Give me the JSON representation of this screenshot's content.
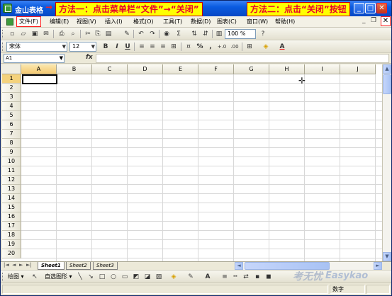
{
  "window": {
    "title": "金山表格",
    "title_arrow": "→",
    "controls": {
      "minimize": "_",
      "maximize": "□",
      "close": "✕"
    }
  },
  "annotations": {
    "method_one": "方法一：点击菜单栏“文件”→“关闭”",
    "method_two": "方法二：点击“关闭”按钮"
  },
  "menubar": {
    "items": [
      "文件(F)",
      "编辑(E)",
      "视图(V)",
      "插入(I)",
      "格式(O)",
      "工具(T)",
      "数据(D)",
      "图表(C)",
      "窗口(W)",
      "帮助(H)"
    ],
    "doc_controls": {
      "minimize": "_",
      "restore": "❐",
      "close": "✕"
    }
  },
  "toolbar": {
    "font_name": "宋体",
    "font_size": "12",
    "zoom": "100 %",
    "bold": "B",
    "italic": "I",
    "underline": "U",
    "sum": "Σ",
    "percent": "%",
    "comma": ",",
    "inc_decimal": "+.0",
    "dec_decimal": ".00",
    "font_color_label": "A",
    "icons": [
      "new-icon",
      "open-icon",
      "save-icon",
      "email-icon",
      "print-icon",
      "print-preview-icon",
      "cut-icon",
      "copy-icon",
      "paste-icon",
      "format-painter-icon",
      "undo-icon",
      "redo-icon",
      "hyperlink-icon",
      "autosum-icon",
      "sort-asc-icon",
      "sort-desc-icon",
      "chart-icon",
      "help-icon"
    ]
  },
  "formula_bar": {
    "cell_ref": "A1",
    "fx": "fx"
  },
  "sheet": {
    "columns": [
      "A",
      "B",
      "C",
      "D",
      "E",
      "F",
      "G",
      "H",
      "I",
      "J"
    ],
    "rows": [
      "1",
      "2",
      "3",
      "4",
      "5",
      "6",
      "7",
      "8",
      "9",
      "10",
      "11",
      "12",
      "13",
      "14",
      "15",
      "16",
      "17",
      "18",
      "19",
      "20"
    ],
    "active_cell": "A1"
  },
  "tabs": {
    "nav": [
      "|◄",
      "◄",
      "►",
      "►|"
    ],
    "sheets": [
      "Sheet1",
      "Sheet2",
      "Sheet3"
    ],
    "active": "Sheet1"
  },
  "drawing_toolbar": {
    "draw_label": "绘图 ▾",
    "autoshapes_label": "自选图形 ▾"
  },
  "watermark": {
    "cn": "考无忧",
    "en": "Easykao"
  },
  "statusbar": {
    "mode": "数字"
  }
}
